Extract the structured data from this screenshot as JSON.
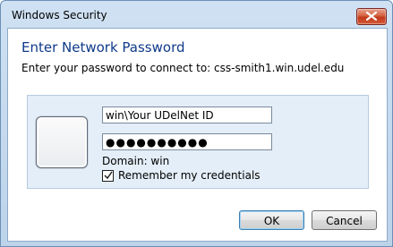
{
  "window": {
    "title": "Windows Security"
  },
  "dialog": {
    "heading": "Enter Network Password",
    "subtext": "Enter your password to connect to: css-smith1.win.udel.edu"
  },
  "credentials": {
    "username_value": "win\\Your UDelNet ID",
    "password_mask": "●●●●●●●●●●",
    "domain_text": "Domain: win",
    "remember_label": "Remember my credentials",
    "remember_checked": true
  },
  "buttons": {
    "ok_label": "OK",
    "cancel_label": "Cancel"
  },
  "colors": {
    "heading": "#0f3a8a",
    "panel_bg": "#e4eef8",
    "close_button": "#c2391b"
  }
}
